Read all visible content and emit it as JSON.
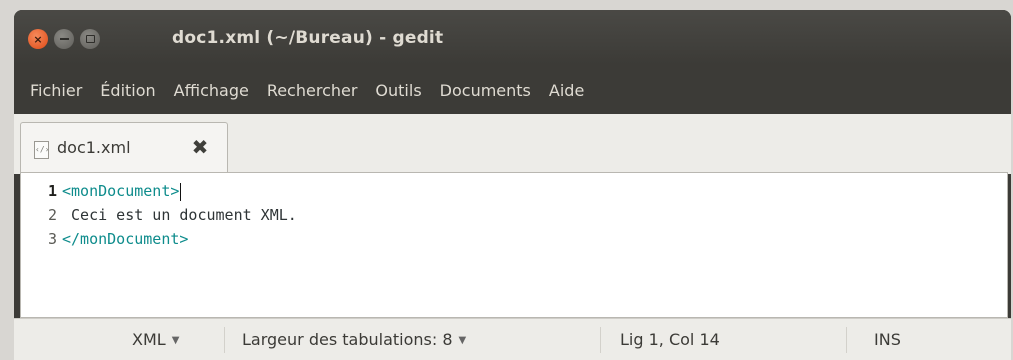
{
  "window": {
    "title": "doc1.xml (~/Bureau) - gedit",
    "buttons": {
      "close": "×",
      "minimize": "",
      "maximize": ""
    }
  },
  "menubar": {
    "items": [
      "Fichier",
      "Édition",
      "Affichage",
      "Rechercher",
      "Outils",
      "Documents",
      "Aide"
    ]
  },
  "tabs": [
    {
      "label": "doc1.xml",
      "icon": "xml-file-icon",
      "close_icon": "✖"
    }
  ],
  "editor": {
    "line_numbers": [
      "1",
      "2",
      "3"
    ],
    "current_line": 1,
    "lines": [
      {
        "tag": "<monDocument>",
        "text": ""
      },
      {
        "tag": "",
        "text": " Ceci est un document XML."
      },
      {
        "tag": "</monDocument>",
        "text": ""
      }
    ],
    "colors": {
      "tag": "#0e8c8c",
      "text": "#2e3436"
    }
  },
  "statusbar": {
    "language": "XML",
    "tab_width": "Largeur des tabulations:  8",
    "position": "Lig 1, Col 14",
    "mode": "INS"
  },
  "colors": {
    "title_bar": "#3c3b37",
    "close_button": "#df4a16",
    "panel": "#edece8"
  }
}
